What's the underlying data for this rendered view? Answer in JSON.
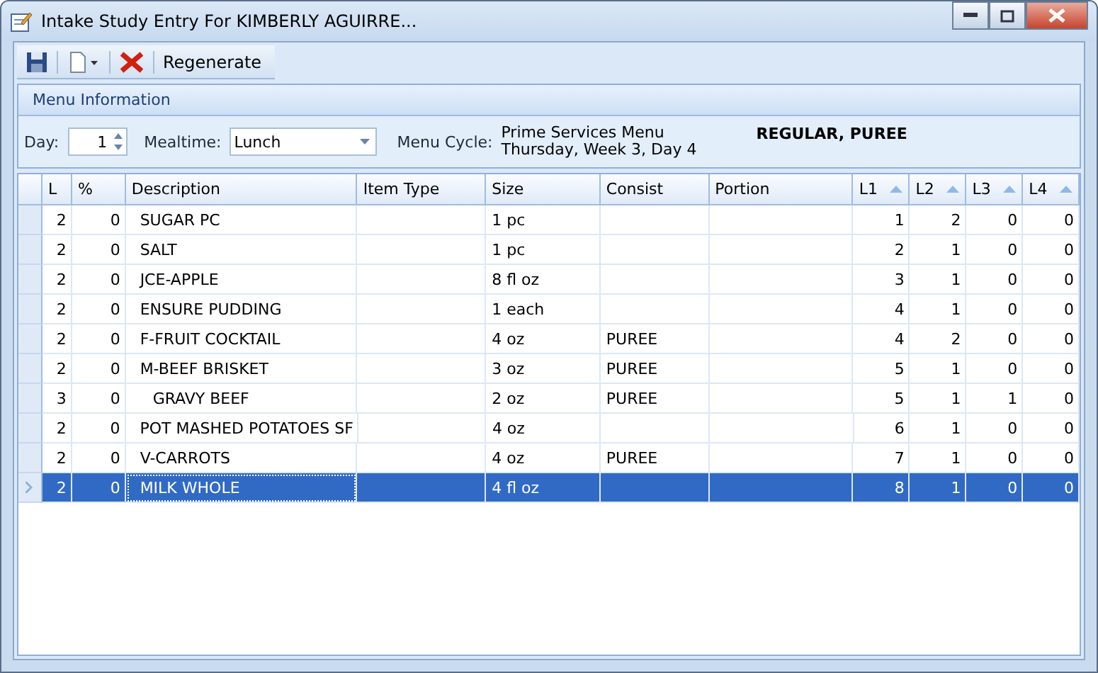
{
  "window": {
    "title": "Intake Study Entry For KIMBERLY AGUIRRE..."
  },
  "toolbar": {
    "regenerate": "Regenerate"
  },
  "menu_information": {
    "title": "Menu Information",
    "day_label": "Day:",
    "day": "1",
    "mealtime_label": "Mealtime:",
    "mealtime": "Lunch",
    "cycle_label": "Menu Cycle:",
    "cycle_line_1": "Prime Services Menu",
    "cycle_line_2": "Thursday, Week 3, Day 4",
    "diet": "REGULAR, PUREE"
  },
  "table": {
    "columns": [
      {
        "label": "L",
        "sorted": false
      },
      {
        "label": "%",
        "sorted": false
      },
      {
        "label": "Description",
        "sorted": false
      },
      {
        "label": "Item Type",
        "sorted": false
      },
      {
        "label": "Size",
        "sorted": false
      },
      {
        "label": "Consist",
        "sorted": false
      },
      {
        "label": "Portion",
        "sorted": false
      },
      {
        "label": "L1",
        "sorted": true
      },
      {
        "label": "L2",
        "sorted": true
      },
      {
        "label": "L3",
        "sorted": true
      },
      {
        "label": "L4",
        "sorted": true
      }
    ],
    "rows": [
      {
        "cells": [
          "2",
          "0",
          "SUGAR PC",
          "",
          "1 pc",
          "",
          "",
          "1",
          "2",
          "0",
          "0"
        ],
        "selected": false
      },
      {
        "cells": [
          "2",
          "0",
          "SALT",
          "",
          "1 pc",
          "",
          "",
          "2",
          "1",
          "0",
          "0"
        ],
        "selected": false
      },
      {
        "cells": [
          "2",
          "0",
          "JCE-APPLE",
          "",
          "8 fl oz",
          "",
          "",
          "3",
          "1",
          "0",
          "0"
        ],
        "selected": false
      },
      {
        "cells": [
          "2",
          "0",
          "ENSURE PUDDING",
          "",
          "1 each",
          "",
          "",
          "4",
          "1",
          "0",
          "0"
        ],
        "selected": false
      },
      {
        "cells": [
          "2",
          "0",
          "F-FRUIT COCKTAIL",
          "",
          "4 oz",
          "PUREE",
          "",
          "4",
          "2",
          "0",
          "0"
        ],
        "selected": false
      },
      {
        "cells": [
          "2",
          "0",
          "M-BEEF BRISKET",
          "",
          "3 oz",
          "PUREE",
          "",
          "5",
          "1",
          "0",
          "0"
        ],
        "selected": false,
        "children": [
          {
            "cells": [
              "3",
              "0",
              "GRAVY BEEF",
              "",
              "2 oz",
              "PUREE",
              "",
              "5",
              "1",
              "1",
              "0"
            ],
            "selected": false
          }
        ]
      },
      {
        "cells": [
          "2",
          "0",
          "POT MASHED POTATOES SF",
          "",
          "4 oz",
          "",
          "",
          "6",
          "1",
          "0",
          "0"
        ],
        "selected": false
      },
      {
        "cells": [
          "2",
          "0",
          "V-CARROTS",
          "",
          "4 oz",
          "PUREE",
          "",
          "7",
          "1",
          "0",
          "0"
        ],
        "selected": false
      },
      {
        "cells": [
          "2",
          "0",
          "MILK WHOLE",
          "",
          "4 fl oz",
          "",
          "",
          "8",
          "1",
          "0",
          "0"
        ],
        "selected": true
      }
    ]
  }
}
